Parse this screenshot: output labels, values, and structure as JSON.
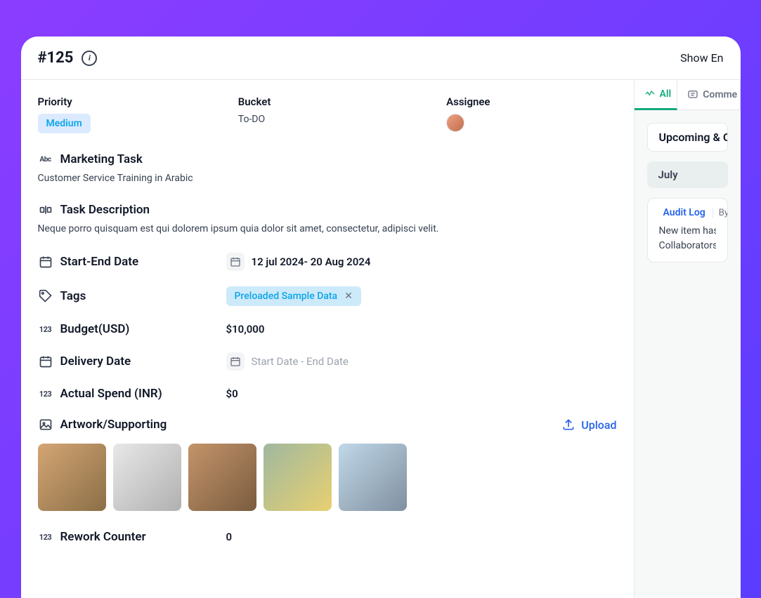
{
  "header": {
    "task_id": "#125",
    "show_more": "Show En"
  },
  "top": {
    "priority_label": "Priority",
    "priority_value": "Medium",
    "bucket_label": "Bucket",
    "bucket_value": "To-DO",
    "assignee_label": "Assignee"
  },
  "fields": {
    "title_label": "Marketing Task",
    "subtitle": "Customer Service Training in Arabic",
    "desc_label": "Task Description",
    "desc_value": "Neque porro quisquam est qui dolorem ipsum quia dolor sit amet, consectetur, adipisci velit.",
    "dates_label": "Start-End Date",
    "dates_value": "12 jul 2024- 20 Aug 2024",
    "tags_label": "Tags",
    "tag_value": "Preloaded Sample Data",
    "budget_label": "Budget(USD)",
    "budget_value": "$10,000",
    "delivery_label": "Delivery Date",
    "delivery_placeholder": "Start Date - End Date",
    "actual_spend_label": "Actual Spend (INR)",
    "actual_spend_value": "$0",
    "artwork_label": "Artwork/Supporting",
    "upload_label": "Upload",
    "rework_label": "Rework Counter",
    "rework_value": "0"
  },
  "sidebar": {
    "tabs": {
      "all": "All",
      "comment": "Comme"
    },
    "status": "Upcoming & Ov",
    "month": "July",
    "audit": {
      "title": "Audit Log",
      "by": "By",
      "msg1": "New item has beer",
      "msg2": "Collaborators, Buc"
    }
  }
}
